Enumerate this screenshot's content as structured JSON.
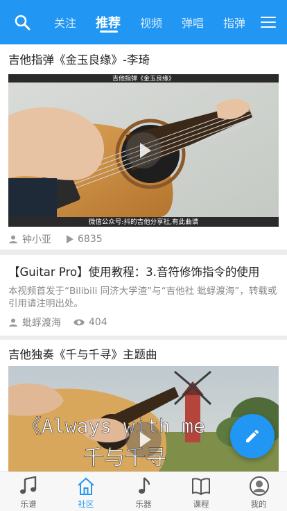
{
  "top_nav": {
    "tabs": [
      "关注",
      "推荐",
      "视频",
      "弹唱",
      "指弹"
    ],
    "active_tab": "推荐"
  },
  "feed": [
    {
      "title": "吉他指弹《金玉良缘》-李琦",
      "video_caption_top": "吉他指弹《金玉良缘》",
      "video_caption_bottom": "微信公众号:抖的吉他分享社,有此曲谱",
      "author": "钟小亚",
      "plays": "6835"
    },
    {
      "title": "【Guitar Pro】使用教程：3.音符修饰指令的使用",
      "description": "本视频首发于“Bilibili 同济大学渣”与“吉他社 蚍蜉渡海”，转载或引用请注明出处。",
      "author": "蚍蜉渡海",
      "views": "404"
    },
    {
      "title": "吉他独奏《千与千寻》主题曲",
      "video_overlay_line1": "《Always with me",
      "video_overlay_line2": "千与千寻"
    }
  ],
  "bottom_nav": {
    "items": [
      "乐谱",
      "社区",
      "乐器",
      "课程",
      "我的"
    ],
    "active": "社区"
  },
  "colors": {
    "primary": "#2196f3",
    "background": "#ececec"
  }
}
